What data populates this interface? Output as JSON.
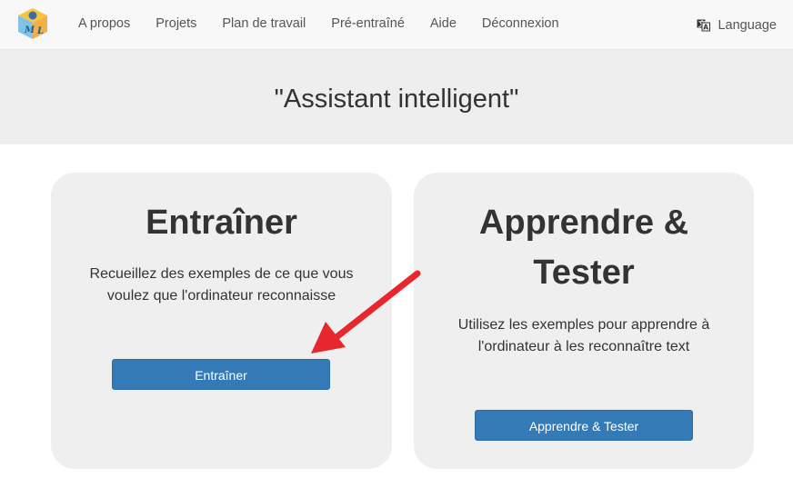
{
  "navbar": {
    "logo_icon": "ml-blocks-logo-icon",
    "links": [
      "A propos",
      "Projets",
      "Plan de travail",
      "Pré-entraîné",
      "Aide",
      "Déconnexion"
    ],
    "language_icon": "translate-icon",
    "language_label": "Language"
  },
  "header": {
    "title": "\"Assistant intelligent\""
  },
  "cards": {
    "train": {
      "title": "Entraîner",
      "description": "Recueillez des exemples de ce que vous voulez que l'ordinateur reconnaisse",
      "button_label": "Entraîner"
    },
    "learn": {
      "title": "Apprendre & Tester",
      "description": "Utilisez les exemples pour apprendre à l'ordinateur à les reconnaître text",
      "button_label": "Apprendre & Tester"
    }
  },
  "annotation": {
    "icon": "red-arrow-icon",
    "color": "#e8262d"
  },
  "colors": {
    "primary_button": "#337ab7",
    "card_background": "#efefef",
    "header_background": "#eeeeee",
    "navbar_background": "#f8f8f8"
  }
}
